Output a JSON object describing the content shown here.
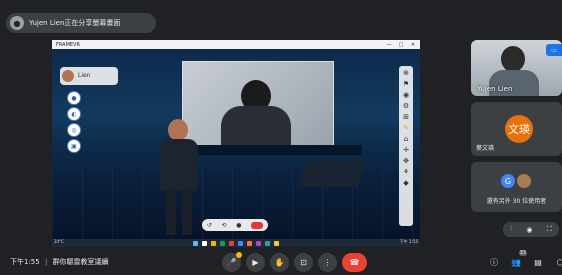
{
  "presenter_chip": {
    "text": "Yujen Lien正在分享螢幕畫面"
  },
  "shared_window": {
    "title": "FRAMEVR",
    "controls": [
      "—",
      "□",
      "✕"
    ],
    "left_toolbar": {
      "label": "Lien"
    },
    "bottom_controls": [
      "↺",
      "⟲",
      "●"
    ],
    "taskbar": {
      "weather": "24°C",
      "clock": "下午 1:55"
    }
  },
  "tiles": {
    "yujen": {
      "name": "Yujen Lien"
    },
    "wenying": {
      "initials": "文瑛",
      "name": "葉文瑛"
    },
    "others": {
      "g": "G",
      "text": "還有另外 30 位使用者"
    }
  },
  "meeting": {
    "time": "下午1:55",
    "sep": "|",
    "name": "群你驅雷教室議續"
  },
  "controls": {
    "mic": "🎤",
    "camera": "▶",
    "hand": "✋",
    "present": "⊡",
    "more": "⋮",
    "end": "☎"
  },
  "right_icons": {
    "info": "ⓘ",
    "people": "👥",
    "people_count": "33",
    "chat": "▤",
    "activities": "⬡"
  },
  "self_controls": {
    "a": "⫶",
    "b": "◉",
    "c": "⛶"
  }
}
